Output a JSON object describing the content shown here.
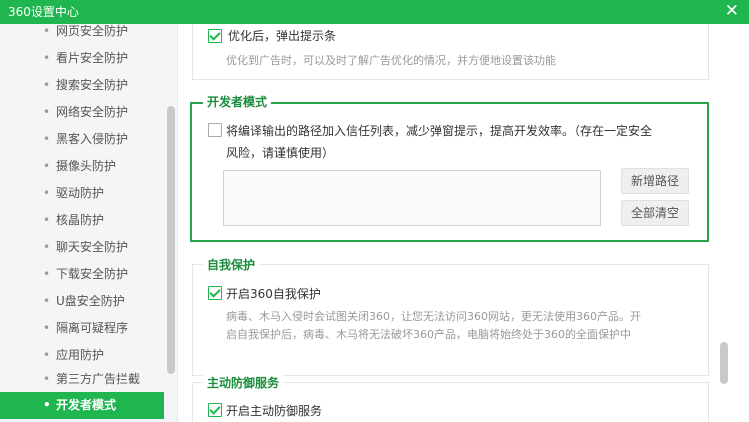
{
  "window": {
    "title": "360设置中心",
    "close_glyph": "✕"
  },
  "sidebar": {
    "items": [
      {
        "label": "网页安全防护"
      },
      {
        "label": "看片安全防护"
      },
      {
        "label": "搜索安全防护"
      },
      {
        "label": "网络安全防护"
      },
      {
        "label": "黑客入侵防护"
      },
      {
        "label": "摄像头防护"
      },
      {
        "label": "驱动防护"
      },
      {
        "label": "核晶防护"
      },
      {
        "label": "聊天安全防护"
      },
      {
        "label": "下载安全防护"
      },
      {
        "label": "U盘安全防护"
      },
      {
        "label": "隔离可疑程序"
      },
      {
        "label": "应用防护"
      },
      {
        "label": "第三方广告拦截"
      },
      {
        "label": "开发者模式",
        "active": true
      }
    ]
  },
  "ad_section": {
    "option_label": "优化后，弹出提示条",
    "option_checked": true,
    "description": "优化到广告时，可以及时了解广告优化的情况，并方便地设置该功能"
  },
  "developer_mode": {
    "title": "开发者模式",
    "option_label_line1": "将编译输出的路径加入信任列表，减少弹窗提示，提高开发效率。（存在一定安全",
    "option_label_line2": "风险，请谨慎使用）",
    "option_checked": false,
    "add_path_label": "新增路径",
    "clear_all_label": "全部清空"
  },
  "self_protect": {
    "title": "自我保护",
    "option_label": "开启360自我保护",
    "option_checked": true,
    "description_line1": "病毒、木马入侵时会试图关闭360，让您无法访问360网站，更无法使用360产品。开",
    "description_line2": "启自我保护后，病毒、木马将无法破坏360产品，电脑将始终处于360的全面保护中"
  },
  "active_defense": {
    "title": "主动防御服务",
    "option_label": "开启主动防御服务",
    "option_checked": true
  },
  "icons": {
    "bullet": "•"
  },
  "colors": {
    "brand_green": "#1fb650",
    "section_title": "#1a8e3c",
    "dev_border": "#2aa34a"
  }
}
